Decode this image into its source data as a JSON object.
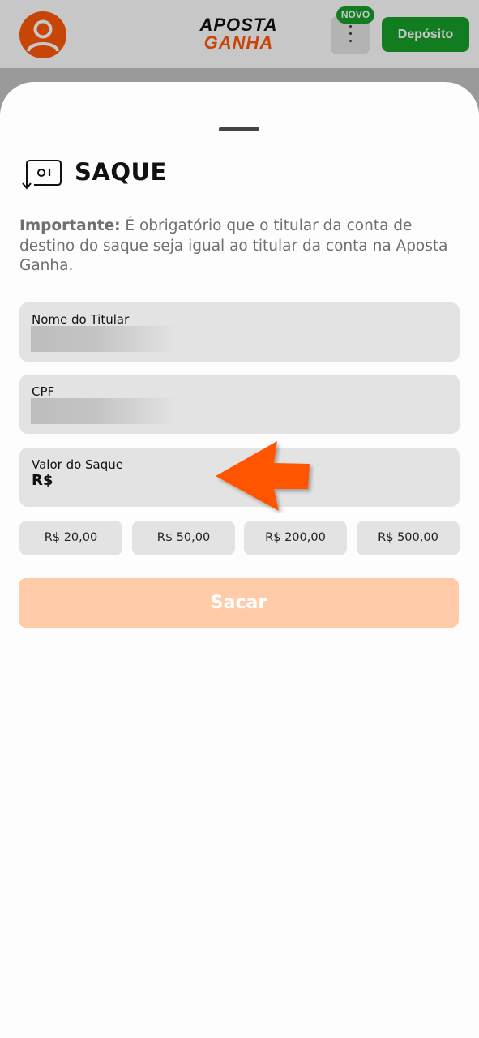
{
  "header": {
    "logo_line1": "APOSTA",
    "logo_line2": "GANHA",
    "badge": "NOVO",
    "deposit_label": "Depósito"
  },
  "sheet": {
    "title": "SAQUE",
    "notice_bold": "Importante:",
    "notice_text": " É obrigatório que o titular da conta de destino do saque seja igual ao titular da conta na Aposta Ganha.",
    "fields": {
      "holder_label": "Nome do Titular",
      "cpf_label": "CPF",
      "amount_label": "Valor do Saque",
      "amount_prefix": "R$",
      "amount_value": ""
    },
    "quick_amounts": [
      "R$ 20,00",
      "R$ 50,00",
      "R$ 200,00",
      "R$ 500,00"
    ],
    "submit_label": "Sacar"
  },
  "colors": {
    "brand_orange": "#ff5a0a",
    "deposit_green": "#16a02a",
    "submit_disabled": "#ffcba9"
  }
}
